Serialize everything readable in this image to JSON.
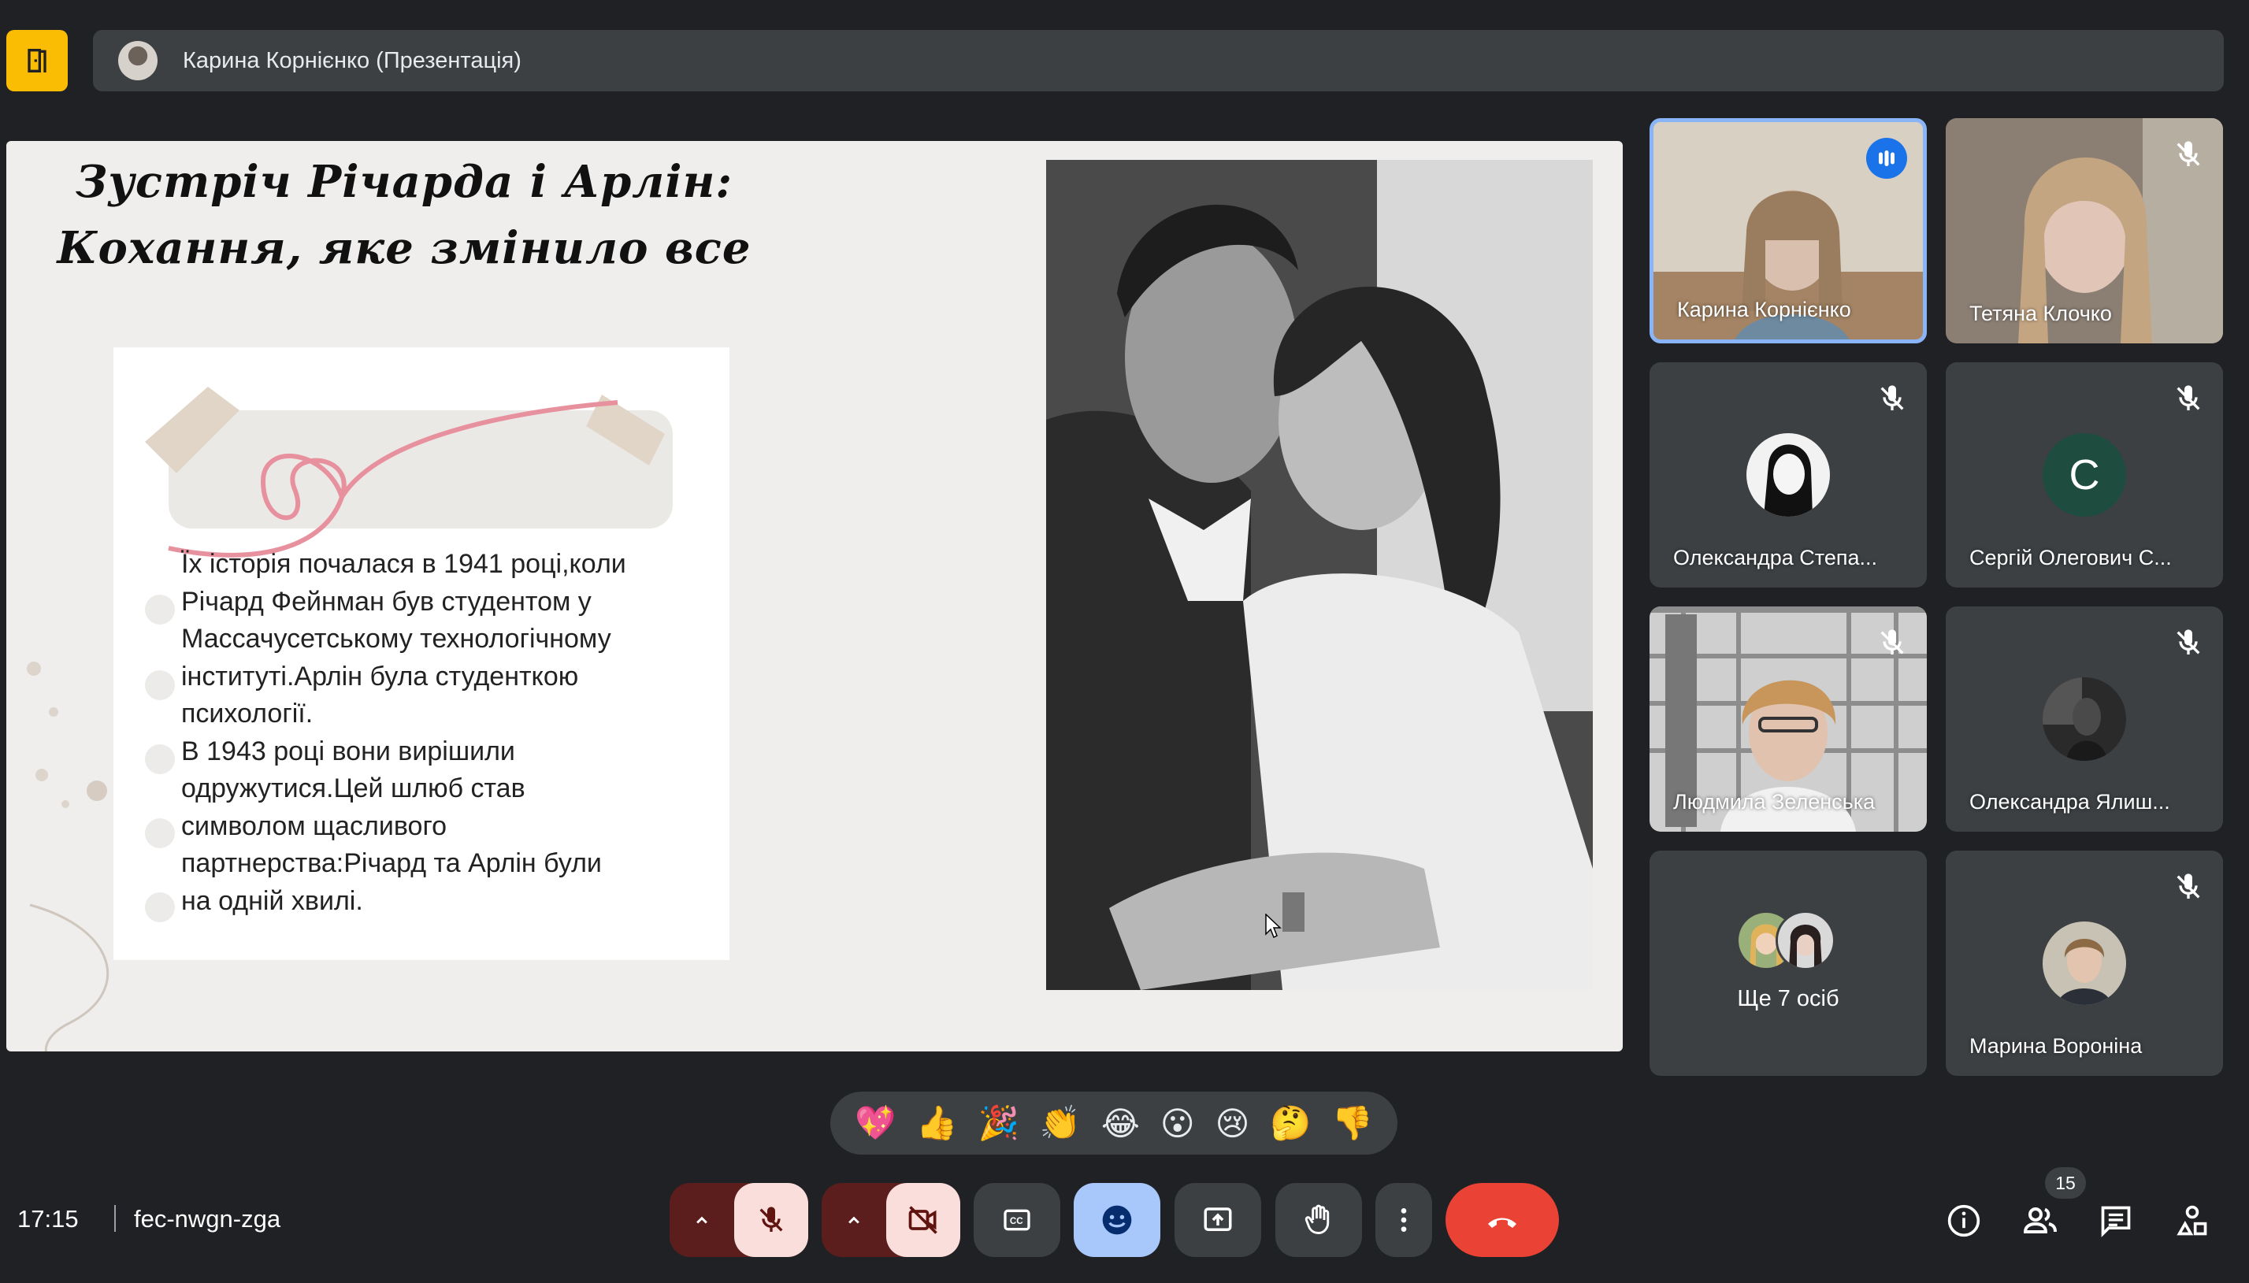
{
  "window": {
    "presenter_label": "Карина Корнієнко (Презентація)"
  },
  "slide": {
    "title": "Зустріч Річарда і Арлін: Кохання, яке змінило все",
    "body_lines": [
      "Їх історія почалася в 1941 році,коли",
      "Річард Фейнман був студентом у",
      "Массачусетському технологічному",
      "інституті.Арлін  була студенткою",
      "психології.",
      "В 1943 році вони вирішили",
      "одружутися.Цей шлюб став",
      "символом щасливого",
      "партнерства:Річард та Арлін були",
      "на одній хвилі."
    ]
  },
  "participants": [
    {
      "name": "Карина Корнієнко",
      "speaking": true
    },
    {
      "name": "Тетяна Клочко",
      "muted": true
    },
    {
      "name": "Олександра Степа...",
      "muted": true
    },
    {
      "name": "Сергій Олегович С...",
      "initial": "С",
      "muted": true
    },
    {
      "name": "Людмила Зеленська",
      "muted": true
    },
    {
      "name": "Олександра Ялиш...",
      "muted": true
    },
    {
      "name": "Ще 7 осіб"
    },
    {
      "name": "Марина Вороніна",
      "muted": true
    }
  ],
  "reactions": [
    "💖",
    "👍",
    "🎉",
    "👏",
    "😂",
    "😮",
    "😢",
    "🤔",
    "👎"
  ],
  "footer": {
    "time": "17:15",
    "meeting_code": "fec-nwgn-zga",
    "people_count": "15"
  },
  "colors": {
    "background": "#202124",
    "surface": "#3c4043",
    "accent_yellow": "#fbbc04",
    "danger": "#ea4335",
    "speaking_border": "#8ab4f8",
    "avatar_green": "#1e4d40",
    "reaction_active": "#a8c7fa"
  },
  "icons": [
    "door-icon",
    "mic-off-icon",
    "camera-off-icon",
    "captions-icon",
    "emoji-icon",
    "present-icon",
    "raise-hand-icon",
    "more-icon",
    "end-call-icon",
    "info-icon",
    "people-icon",
    "chat-icon",
    "activities-icon"
  ]
}
